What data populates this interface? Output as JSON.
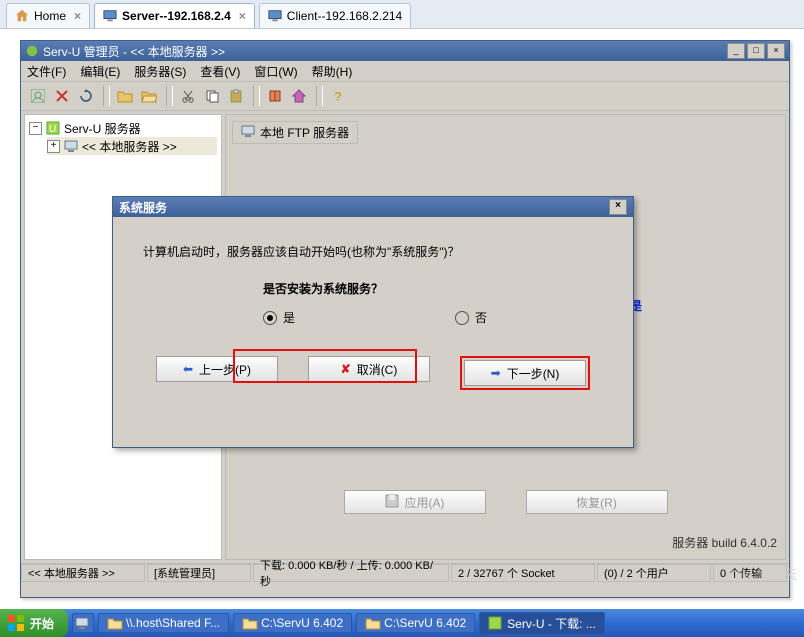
{
  "browser_tabs": [
    {
      "label": "Home",
      "closable": true,
      "icon": "house"
    },
    {
      "label": "Server--192.168.2.4",
      "active": true,
      "closable": true,
      "icon": "monitor"
    },
    {
      "label": "Client--192.168.2.214",
      "closable": false,
      "icon": "monitor"
    }
  ],
  "window": {
    "title": "Serv-U 管理员 - << 本地服务器 >>",
    "menu": [
      "文件(F)",
      "编辑(E)",
      "服务器(S)",
      "查看(V)",
      "窗口(W)",
      "帮助(H)"
    ]
  },
  "tree": {
    "root": "Serv-U 服务器",
    "child": "<< 本地服务器 >>"
  },
  "right_tab": "本地 FTP 服务器",
  "server_build": "服务器 build 6.4.0.2",
  "gray_btns": {
    "apply": "应用(A)",
    "restore": "恢复(R)"
  },
  "statusbar": {
    "local": "<< 本地服务器 >>",
    "admin": "[系统管理员]",
    "rate": "下载: 0.000 KB/秒 / 上传: 0.000 KB/秒",
    "sockets": "2 / 32767 个 Socket",
    "users": "(0) / 2 个用户",
    "xfer": "0 个传输"
  },
  "dialog": {
    "title": "系统服务",
    "prompt": "计算机启动时，服务器应该自动开始吗(也称为\"系统服务\")？",
    "question": "是否安装为系统服务？",
    "yes": "是",
    "no": "否",
    "back": "上一步(P)",
    "cancel": "取消(C)",
    "next": "下一步(N)",
    "annotation": "这里填当然是"
  },
  "taskbar": {
    "start": "开始",
    "items": [
      {
        "label": "\\\\.host\\Shared F...",
        "icon": "folder"
      },
      {
        "label": "C:\\ServU 6.402",
        "icon": "folder"
      },
      {
        "label": "C:\\ServU 6.402",
        "icon": "folder"
      },
      {
        "label": "Serv-U - 下载: ...",
        "icon": "servu",
        "active": true
      }
    ]
  },
  "watermark": "亿速云"
}
